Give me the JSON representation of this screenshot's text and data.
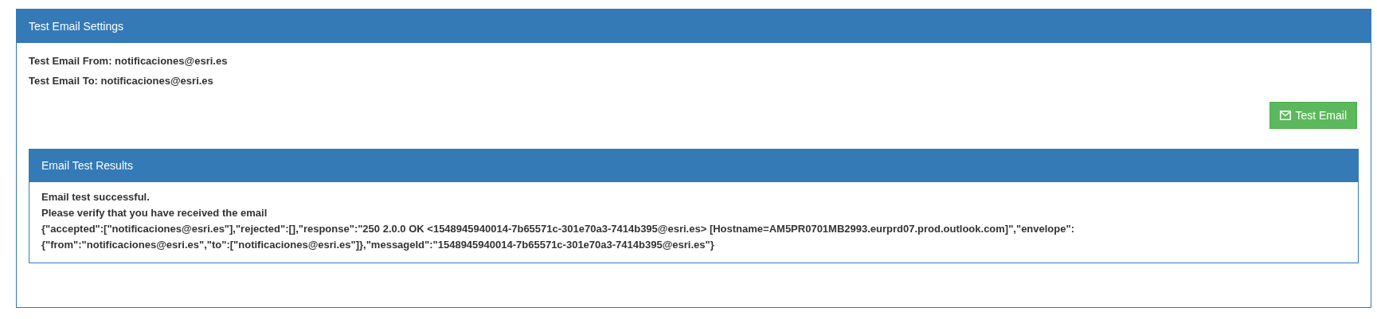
{
  "settings_panel": {
    "title": "Test Email Settings",
    "fields": [
      {
        "label": "Test Email From:",
        "value": "notificaciones@esri.es"
      },
      {
        "label": "Test Email To:",
        "value": "notificaciones@esri.es"
      }
    ],
    "button": "Test Email"
  },
  "results_panel": {
    "title": "Email Test Results",
    "lines": [
      "Email test successful.",
      "Please verify that you have received the email",
      "{\"accepted\":[\"notificaciones@esri.es\"],\"rejected\":[],\"response\":\"250 2.0.0 OK <1548945940014-7b65571c-301e70a3-7414b395@esri.es> [Hostname=AM5PR0701MB2993.eurprd07.prod.outlook.com]\",\"envelope\":",
      "{\"from\":\"notificaciones@esri.es\",\"to\":[\"notificaciones@esri.es\"]},\"messageId\":\"1548945940014-7b65571c-301e70a3-7414b395@esri.es\"}"
    ]
  }
}
